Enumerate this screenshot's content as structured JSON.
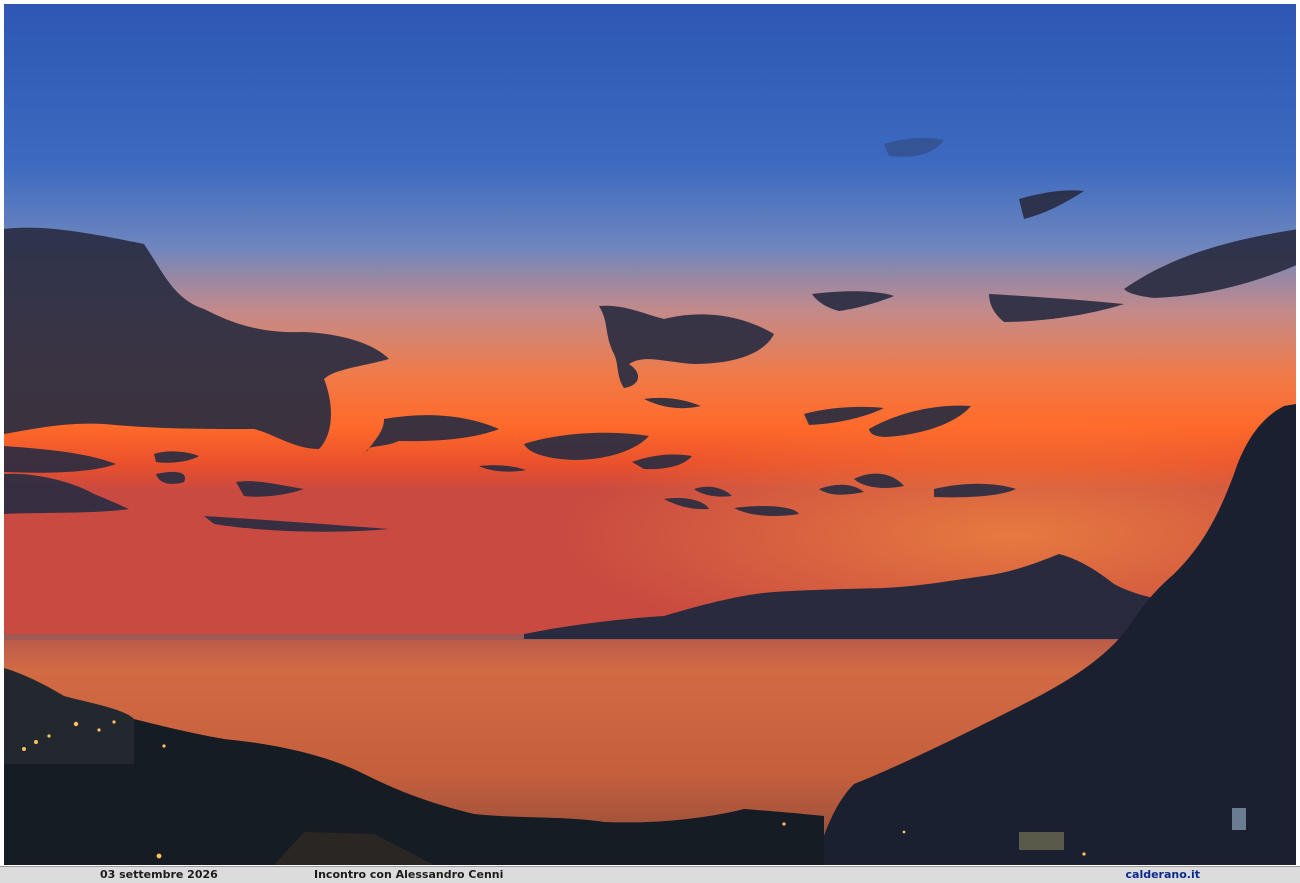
{
  "caption": {
    "date": "03 settembre 2026",
    "title": "Incontro con Alessandro Cenni",
    "site": "calderano.it"
  },
  "colors": {
    "sky_top": "#2f58b4",
    "sky_mid": "#7d88b6",
    "horizon_orange": "#ff6a2a",
    "horizon_red": "#e2452a",
    "sea": "#c9643e",
    "silhouette": "#1d2233",
    "caption_bar": "#dcdcdc",
    "site_link": "#0a2a8c"
  }
}
